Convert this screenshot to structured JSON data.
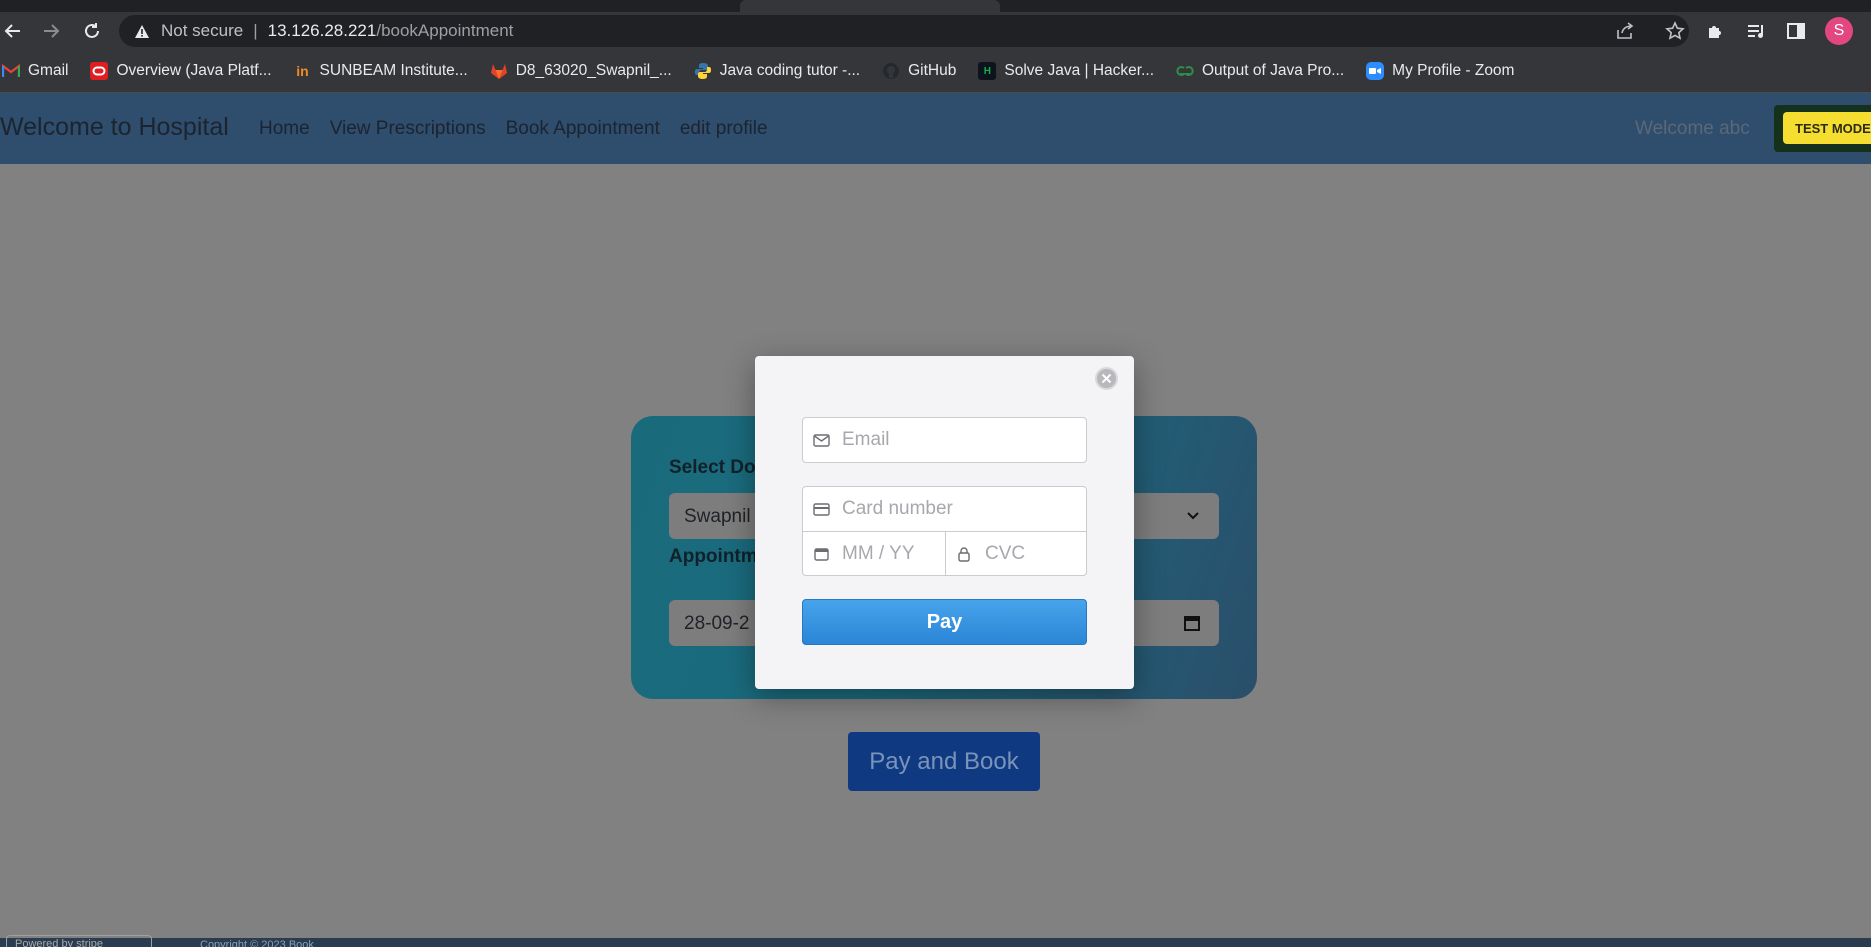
{
  "browser": {
    "security_text": "Not secure",
    "url_host": "13.126.28.221",
    "url_path": "/bookAppointment",
    "profile_initial": "S",
    "bookmarks": [
      {
        "label": "Gmail",
        "icon": "gmail-icon",
        "color": "#ea4335"
      },
      {
        "label": "Overview (Java Platf...",
        "icon": "oracle-icon",
        "color": "#e01e22"
      },
      {
        "label": "SUNBEAM Institute...",
        "icon": "sunbeam-icon",
        "color": "#f08a24"
      },
      {
        "label": "D8_63020_Swapnil_...",
        "icon": "gitlab-icon",
        "color": "#e24329"
      },
      {
        "label": "Java coding tutor -...",
        "icon": "python-icon",
        "color": "#3776ab"
      },
      {
        "label": "GitHub",
        "icon": "github-icon",
        "color": "#24292e"
      },
      {
        "label": "Solve Java | Hacker...",
        "icon": "hackerrank-icon",
        "color": "#1ba94c"
      },
      {
        "label": "Output of Java Pro...",
        "icon": "geeksforgeeks-icon",
        "color": "#2f8d46"
      },
      {
        "label": "My Profile - Zoom",
        "icon": "zoom-icon",
        "color": "#2d8cff"
      }
    ]
  },
  "navbar": {
    "brand": "Welcome to Hospital",
    "links": [
      "Home",
      "View Prescriptions",
      "Book Appointment",
      "edit profile"
    ],
    "welcome": "Welcome abc",
    "test_mode": "TEST MODE"
  },
  "form": {
    "doctor_label": "Select Do",
    "doctor_value": "Swapnil",
    "date_label": "Appointm",
    "date_value": "28-09-2",
    "submit_label": "Pay and Book"
  },
  "stripe": {
    "email_placeholder": "Email",
    "card_placeholder": "Card number",
    "expiry_placeholder": "MM / YY",
    "cvc_placeholder": "CVC",
    "pay_label": "Pay",
    "badge_text": "Powered by stripe",
    "footer_text": "Copyright © 2023 Book"
  },
  "colors": {
    "navbar": "#2f4d6c",
    "pay_button": "#2a86d6",
    "test_mode": "#f5de2f",
    "submit_button": "#0f3a82"
  }
}
